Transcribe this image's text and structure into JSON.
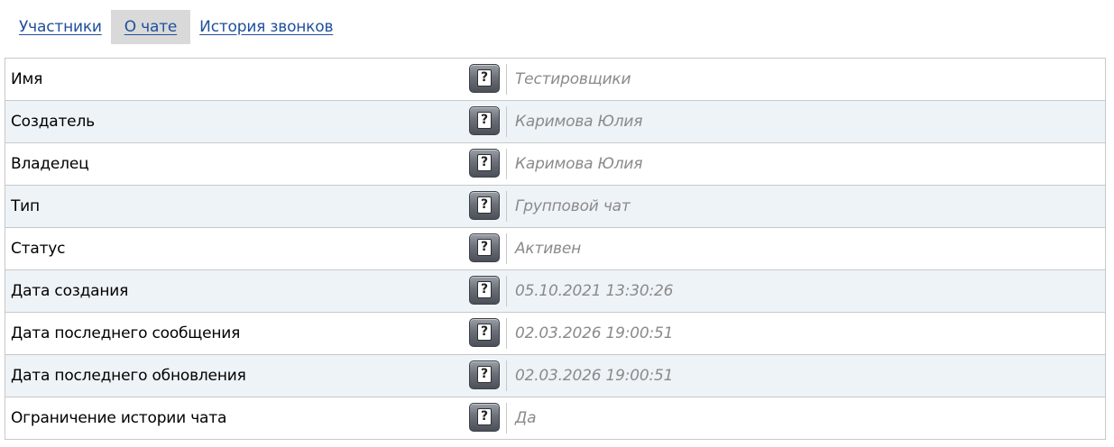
{
  "tabs": [
    {
      "label": "Участники",
      "active": false
    },
    {
      "label": "О чате",
      "active": true
    },
    {
      "label": "История звонков",
      "active": false
    }
  ],
  "help_glyph": "?",
  "properties": [
    {
      "label": "Имя",
      "value": "Тестировщики"
    },
    {
      "label": "Создатель",
      "value": "Каримова Юлия"
    },
    {
      "label": "Владелец",
      "value": "Каримова Юлия"
    },
    {
      "label": "Тип",
      "value": "Групповой чат"
    },
    {
      "label": "Статус",
      "value": "Активен"
    },
    {
      "label": "Дата создания",
      "value": "05.10.2021 13:30:26"
    },
    {
      "label": "Дата последнего сообщения",
      "value": "02.03.2026 19:00:51"
    },
    {
      "label": "Дата последнего обновления",
      "value": "02.03.2026 19:00:51"
    },
    {
      "label": "Ограничение истории чата",
      "value": "Да"
    }
  ],
  "colors": {
    "link": "#1f4f9c",
    "active_tab_bg": "#d9d9d9",
    "row_alt_bg": "#eef3f8",
    "value_text": "#8a8a8a",
    "border": "#c8c8c8"
  }
}
